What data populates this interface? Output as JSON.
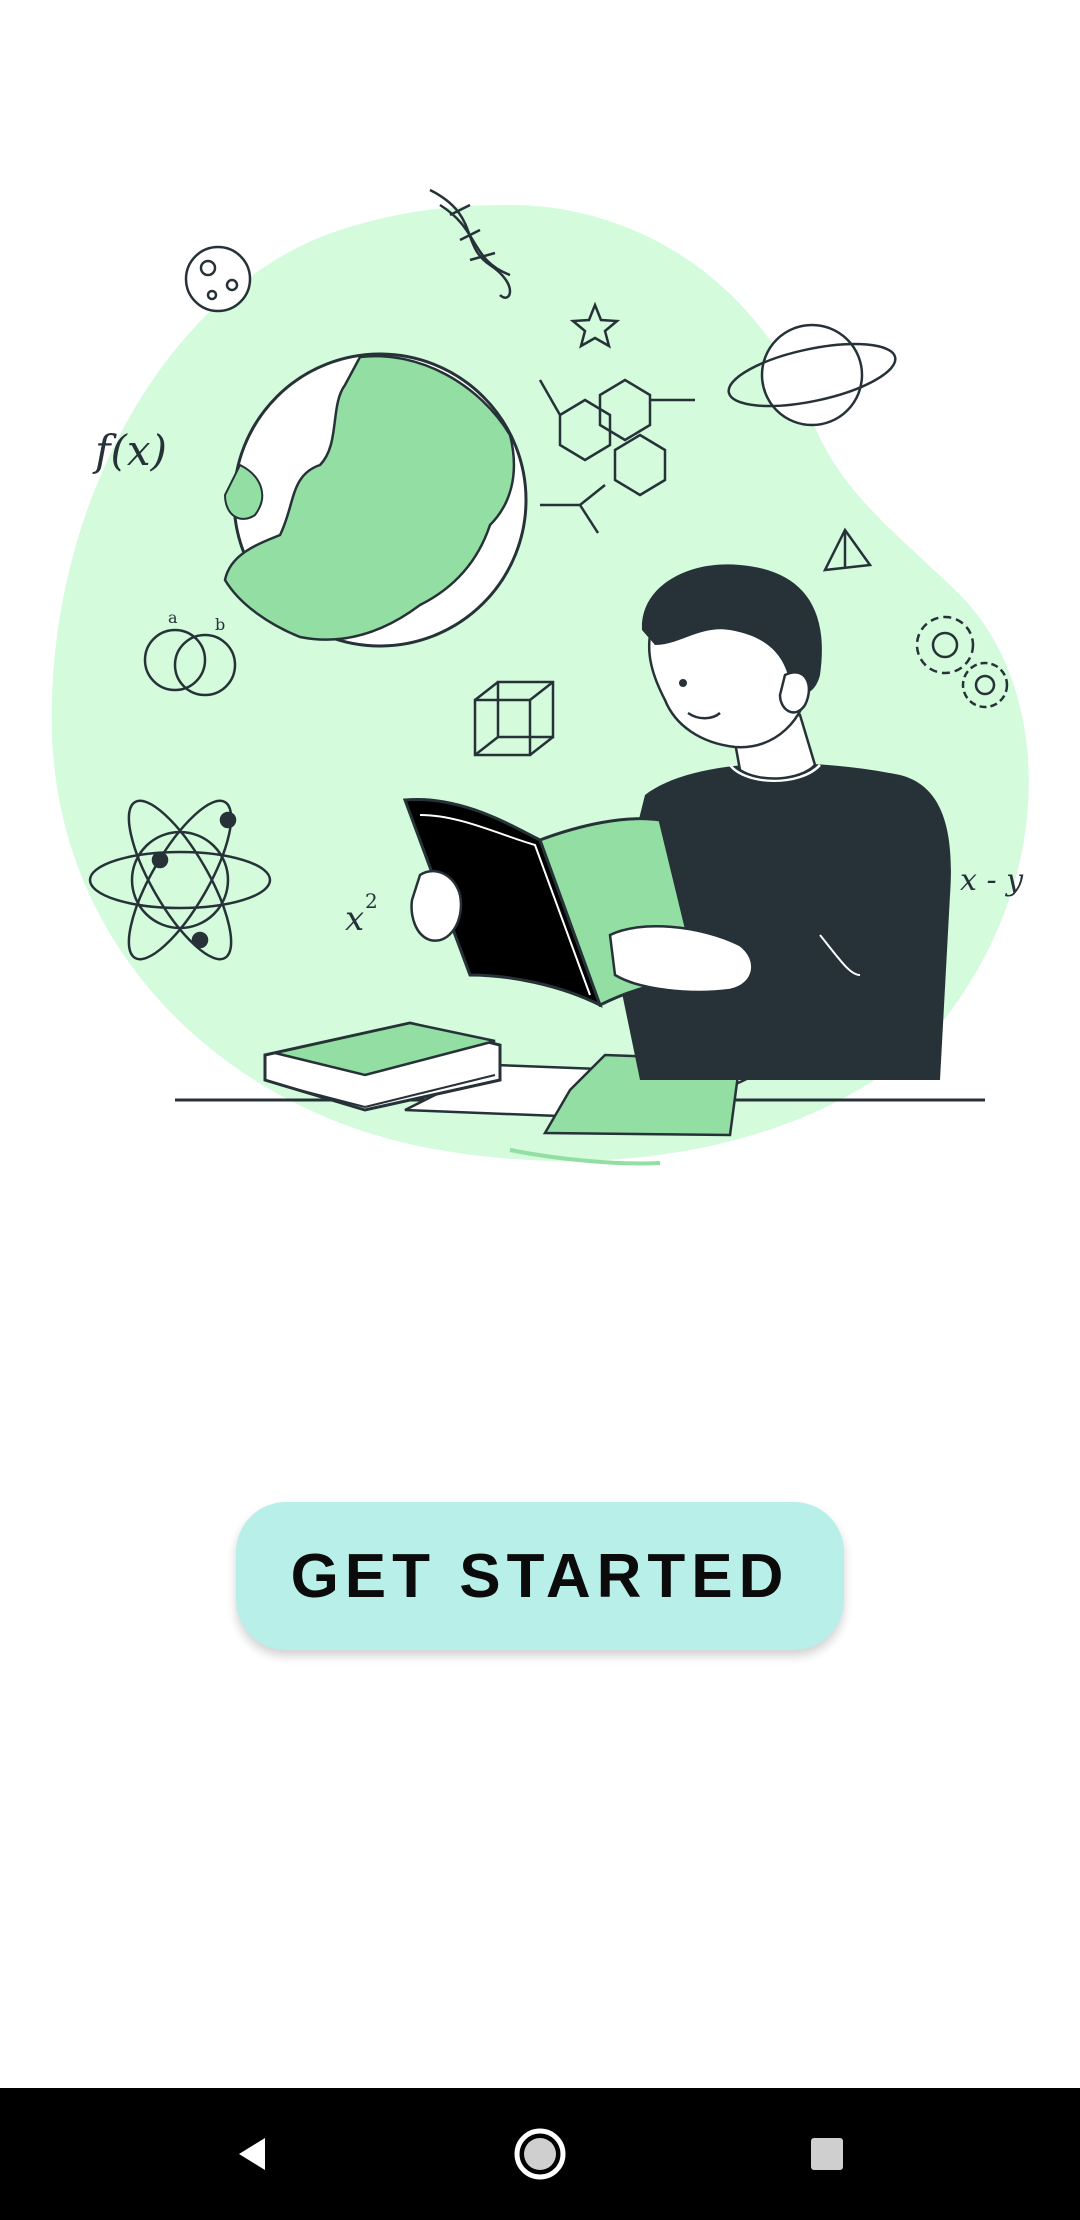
{
  "onboarding": {
    "cta_label": "GET STARTED"
  },
  "illustration": {
    "subject": "person reading a book at a desk",
    "glyphs": {
      "fx": "f(x)",
      "x2_base": "x",
      "x2_exp": "2",
      "xy": "x - y",
      "a": "a",
      "b": "b"
    }
  },
  "colors": {
    "accent_blob": "#d3fbdc",
    "accent_green": "#93dea2",
    "button_bg": "#b9efe9",
    "ink": "#263238",
    "nav_bg": "#000000"
  },
  "navbar": {
    "icons": [
      "back-icon",
      "home-icon",
      "recents-icon"
    ]
  }
}
